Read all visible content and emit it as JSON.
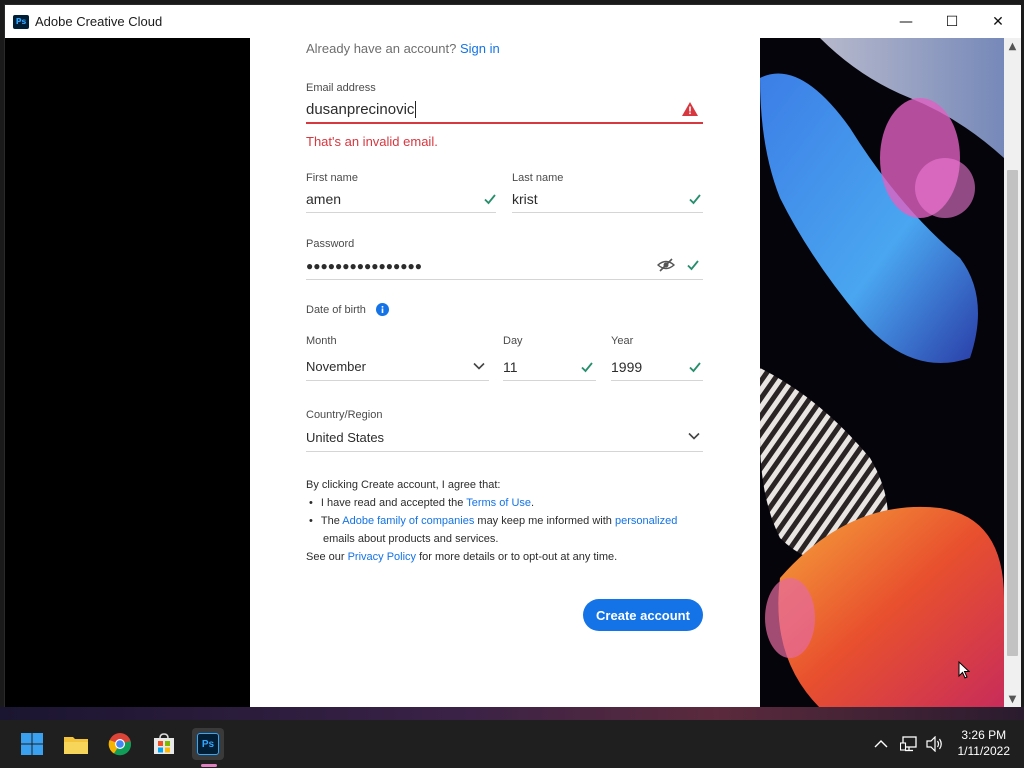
{
  "window": {
    "title": "Adobe Creative Cloud",
    "app_icon_text": "Ps",
    "minimize": "—",
    "maximize": "☐",
    "close": "✕"
  },
  "signin": {
    "prompt": "Already have an account?",
    "link": "Sign in"
  },
  "email": {
    "label": "Email address",
    "value": "dusanprecinovic",
    "error": "That's an invalid email."
  },
  "first_name": {
    "label": "First name",
    "value": "amen"
  },
  "last_name": {
    "label": "Last name",
    "value": "krist"
  },
  "password": {
    "label": "Password",
    "value": "●●●●●●●●●●●●●●●●"
  },
  "dob": {
    "label": "Date of birth",
    "month_label": "Month",
    "month_value": "November",
    "day_label": "Day",
    "day_value": "11",
    "year_label": "Year",
    "year_value": "1999"
  },
  "country": {
    "label": "Country/Region",
    "value": "United States"
  },
  "terms": {
    "intro": "By clicking Create account, I agree that:",
    "b1_pre": "I have read and accepted the ",
    "b1_link": "Terms of Use",
    "b1_post": ".",
    "b2_pre": "The ",
    "b2_link1": "Adobe family of companies",
    "b2_mid": " may keep me informed with ",
    "b2_link2": "personalized",
    "b2_line2": "emails about products and services.",
    "see_pre": "See our ",
    "see_link": "Privacy Policy",
    "see_post": " for more details or to opt-out at any time."
  },
  "create_button": "Create account",
  "taskbar": {
    "ps_label": "Ps",
    "time": "3:26 PM",
    "date": "1/11/2022"
  },
  "colors": {
    "accent": "#1473e6",
    "error": "#d7373f",
    "valid": "#268e6c"
  }
}
